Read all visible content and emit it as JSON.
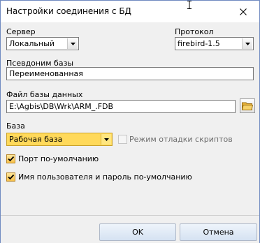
{
  "window": {
    "title": "Настройки соединения с БД"
  },
  "server": {
    "label": "Сервер",
    "value": "Локальный"
  },
  "protocol": {
    "label": "Протокол",
    "value": "firebird-1.5"
  },
  "alias": {
    "label": "Псевдоним базы",
    "value": "Переименованная"
  },
  "dbfile": {
    "label": "Файл базы данных",
    "value": "E:\\Agbis\\DB\\Wrk\\ARM_.FDB"
  },
  "database": {
    "label": "База",
    "value": "Рабочая база",
    "highlight_color": "#ffd95a"
  },
  "debug_mode": {
    "label": "Режим отладки скриптов",
    "checked": false,
    "enabled": false
  },
  "default_port": {
    "label": "Порт по-умолчанию",
    "checked": true
  },
  "default_credentials": {
    "label": "Имя пользователя и пароль по-умолчанию",
    "checked": true
  },
  "buttons": {
    "ok_label": "OK",
    "cancel_label": "Отмена"
  },
  "icons": {
    "close": "close-icon",
    "dropdown": "chevron-down-icon",
    "folder": "folder-icon",
    "check": "check-icon",
    "cursor": "text-cursor-icon"
  }
}
